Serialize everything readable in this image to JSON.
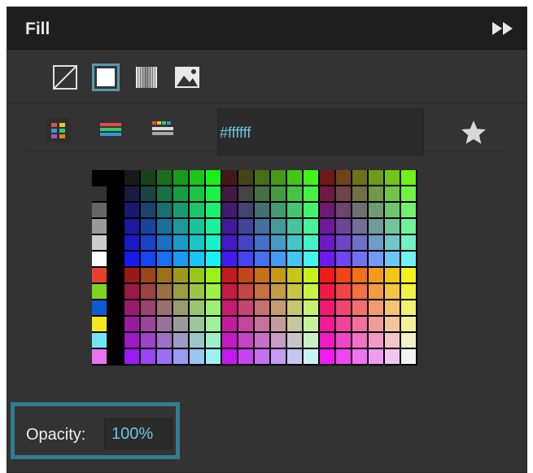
{
  "panel": {
    "title": "Fill",
    "collapse_icon": "double-chevron-right-icon"
  },
  "fill_types": [
    {
      "name": "no-fill",
      "icon": "no-fill-icon",
      "selected": false
    },
    {
      "name": "solid-fill",
      "icon": "solid-fill-icon",
      "selected": true
    },
    {
      "name": "gradient-fill",
      "icon": "gradient-fill-icon",
      "selected": false
    },
    {
      "name": "image-fill",
      "icon": "image-fill-icon",
      "selected": false
    }
  ],
  "palette_modes": [
    {
      "name": "grid-palette",
      "icon": "swatch-grid-icon",
      "selected": true
    },
    {
      "name": "bars-palette",
      "icon": "color-bars-icon",
      "selected": false
    },
    {
      "name": "strip-palette",
      "icon": "color-strip-icon",
      "selected": false
    }
  ],
  "color": {
    "hex_value": "#ffffff"
  },
  "favorite_icon": "star-icon",
  "opacity": {
    "label": "Opacity:",
    "value": "100%"
  },
  "colors": {
    "accent": "#6fc3df",
    "highlight_border": "#2f7e90",
    "panel_bg": "#333333",
    "header_bg": "#1e1e1e"
  }
}
